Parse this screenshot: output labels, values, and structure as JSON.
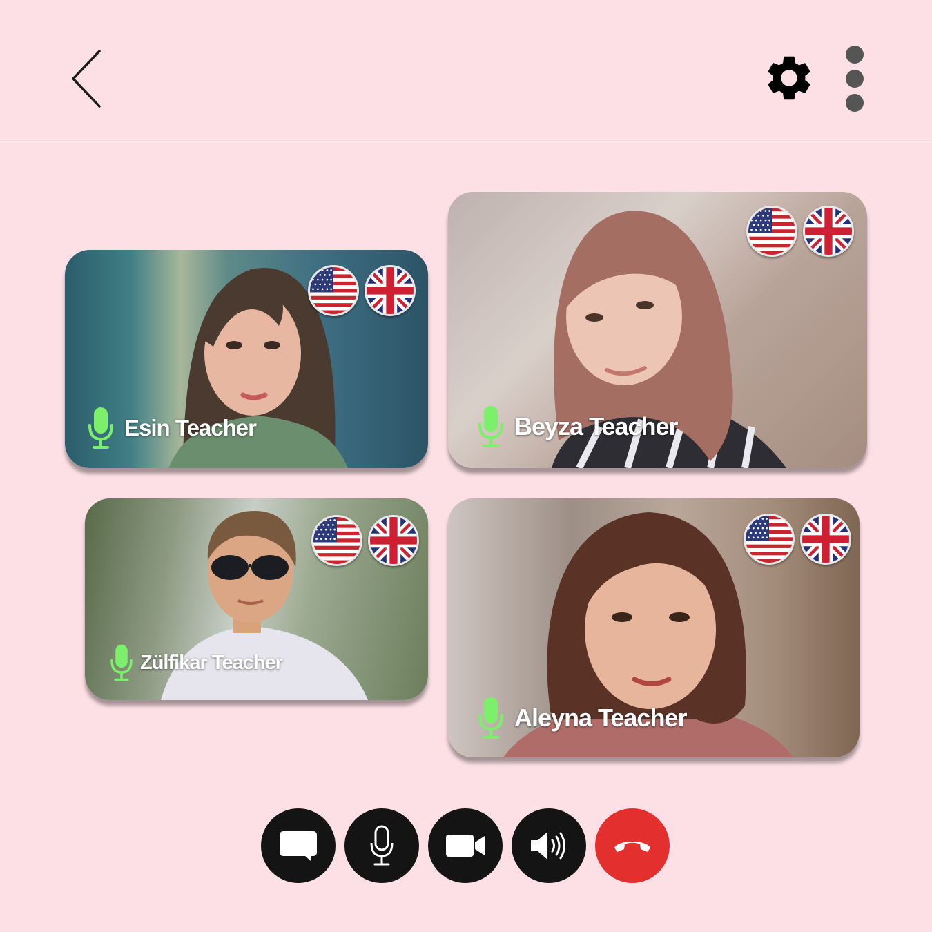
{
  "header": {
    "back_icon": "chevron-left-icon",
    "settings_icon": "gear-icon",
    "more_icon": "more-vertical-icon"
  },
  "participants": [
    {
      "name": "Esin Teacher",
      "mic_icon": "mic-icon",
      "mic_color": "#7cf06a",
      "flags": [
        "us-flag-icon",
        "uk-flag-icon"
      ]
    },
    {
      "name": "Beyza Teacher",
      "mic_icon": "mic-icon",
      "mic_color": "#7cf06a",
      "flags": [
        "us-flag-icon",
        "uk-flag-icon"
      ]
    },
    {
      "name": "Zülfikar Teacher",
      "mic_icon": "mic-icon",
      "mic_color": "#7cf06a",
      "flags": [
        "us-flag-icon",
        "uk-flag-icon"
      ]
    },
    {
      "name": "Aleyna Teacher",
      "mic_icon": "mic-icon",
      "mic_color": "#7cf06a",
      "flags": [
        "us-flag-icon",
        "uk-flag-icon"
      ]
    }
  ],
  "controls": [
    {
      "icon": "chat-icon"
    },
    {
      "icon": "mic-icon"
    },
    {
      "icon": "video-camera-icon"
    },
    {
      "icon": "speaker-icon"
    },
    {
      "icon": "end-call-icon",
      "color": "#e42f2f"
    }
  ],
  "colors": {
    "background": "#fde0e6",
    "control_bg": "#141414",
    "end_call": "#e42f2f",
    "mic_active": "#7cf06a"
  }
}
